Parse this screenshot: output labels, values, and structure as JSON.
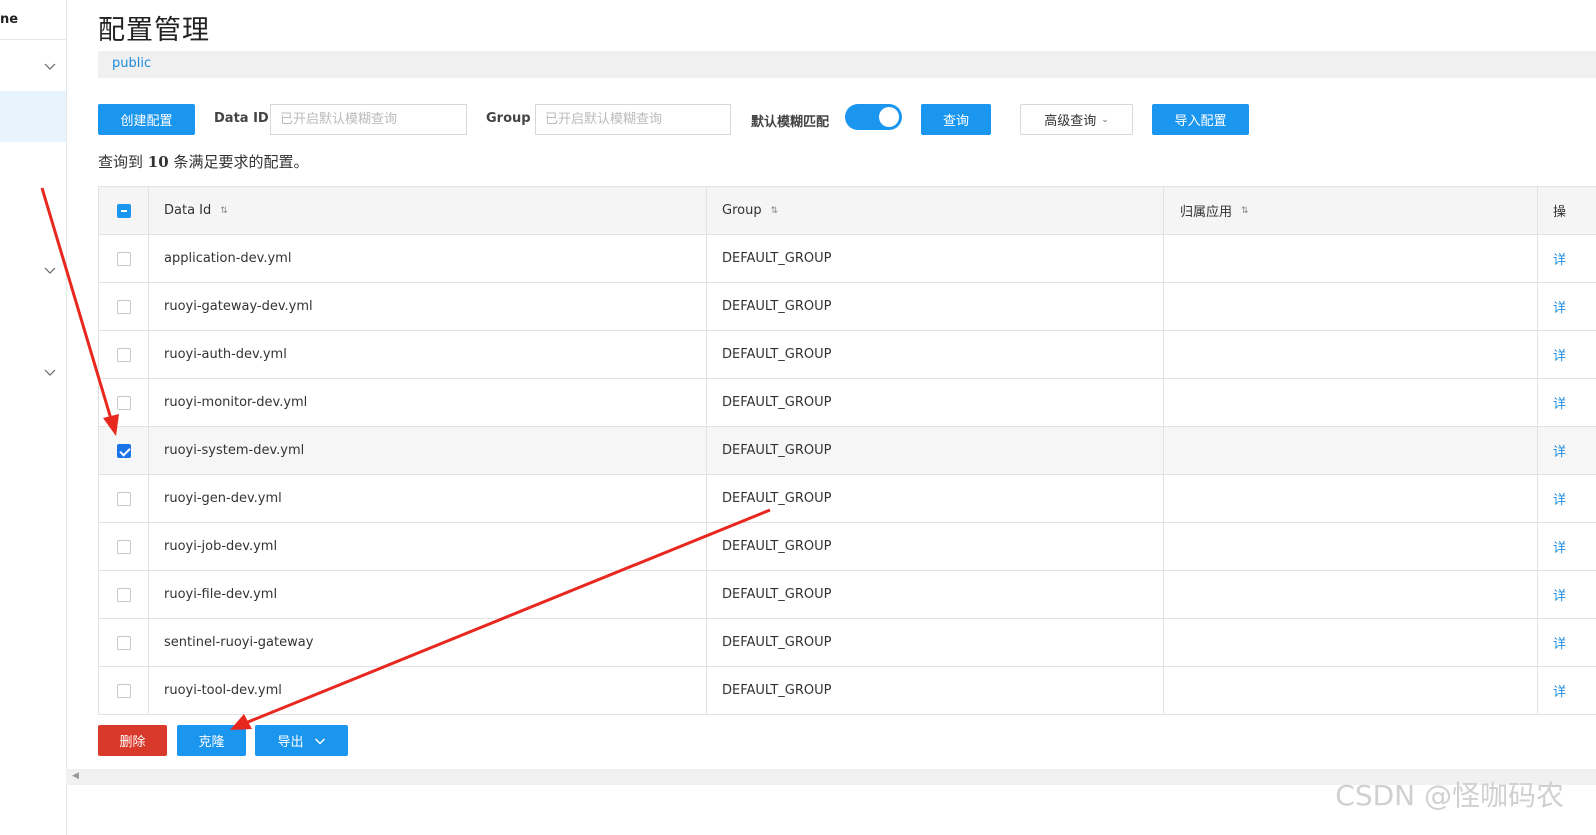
{
  "sidebar": {
    "brand": "ne"
  },
  "page": {
    "title": "配置管理"
  },
  "namespace": {
    "active": "public"
  },
  "toolbar": {
    "create_label": "创建配置",
    "dataid_label": "Data ID",
    "dataid_placeholder": "已开启默认模糊查询",
    "group_label": "Group",
    "group_placeholder": "已开启默认模糊查询",
    "fuzzy_label": "默认模糊匹配",
    "fuzzy_on": true,
    "query_label": "查询",
    "advanced_label": "高级查询",
    "import_label": "导入配置"
  },
  "summary": {
    "prefix": "查询到",
    "count": "10",
    "suffix": "条满足要求的配置。"
  },
  "table": {
    "headers": {
      "data_id": "Data Id",
      "group": "Group",
      "app": "归属应用",
      "ops": "操"
    },
    "rows": [
      {
        "data_id": "application-dev.yml",
        "group": "DEFAULT_GROUP",
        "app": "",
        "op": "详",
        "checked": false
      },
      {
        "data_id": "ruoyi-gateway-dev.yml",
        "group": "DEFAULT_GROUP",
        "app": "",
        "op": "详",
        "checked": false
      },
      {
        "data_id": "ruoyi-auth-dev.yml",
        "group": "DEFAULT_GROUP",
        "app": "",
        "op": "详",
        "checked": false
      },
      {
        "data_id": "ruoyi-monitor-dev.yml",
        "group": "DEFAULT_GROUP",
        "app": "",
        "op": "详",
        "checked": false
      },
      {
        "data_id": "ruoyi-system-dev.yml",
        "group": "DEFAULT_GROUP",
        "app": "",
        "op": "详",
        "checked": true
      },
      {
        "data_id": "ruoyi-gen-dev.yml",
        "group": "DEFAULT_GROUP",
        "app": "",
        "op": "详",
        "checked": false
      },
      {
        "data_id": "ruoyi-job-dev.yml",
        "group": "DEFAULT_GROUP",
        "app": "",
        "op": "详",
        "checked": false
      },
      {
        "data_id": "ruoyi-file-dev.yml",
        "group": "DEFAULT_GROUP",
        "app": "",
        "op": "详",
        "checked": false
      },
      {
        "data_id": "sentinel-ruoyi-gateway",
        "group": "DEFAULT_GROUP",
        "app": "",
        "op": "详",
        "checked": false
      },
      {
        "data_id": "ruoyi-tool-dev.yml",
        "group": "DEFAULT_GROUP",
        "app": "",
        "op": "详",
        "checked": false
      }
    ]
  },
  "footer": {
    "delete_label": "删除",
    "clone_label": "克隆",
    "export_label": "导出"
  },
  "watermark": "CSDN @怪咖码农",
  "colors": {
    "primary": "#1b96ef",
    "danger": "#d8392b",
    "link": "#1a8cde",
    "annotation": "#e8281e"
  }
}
